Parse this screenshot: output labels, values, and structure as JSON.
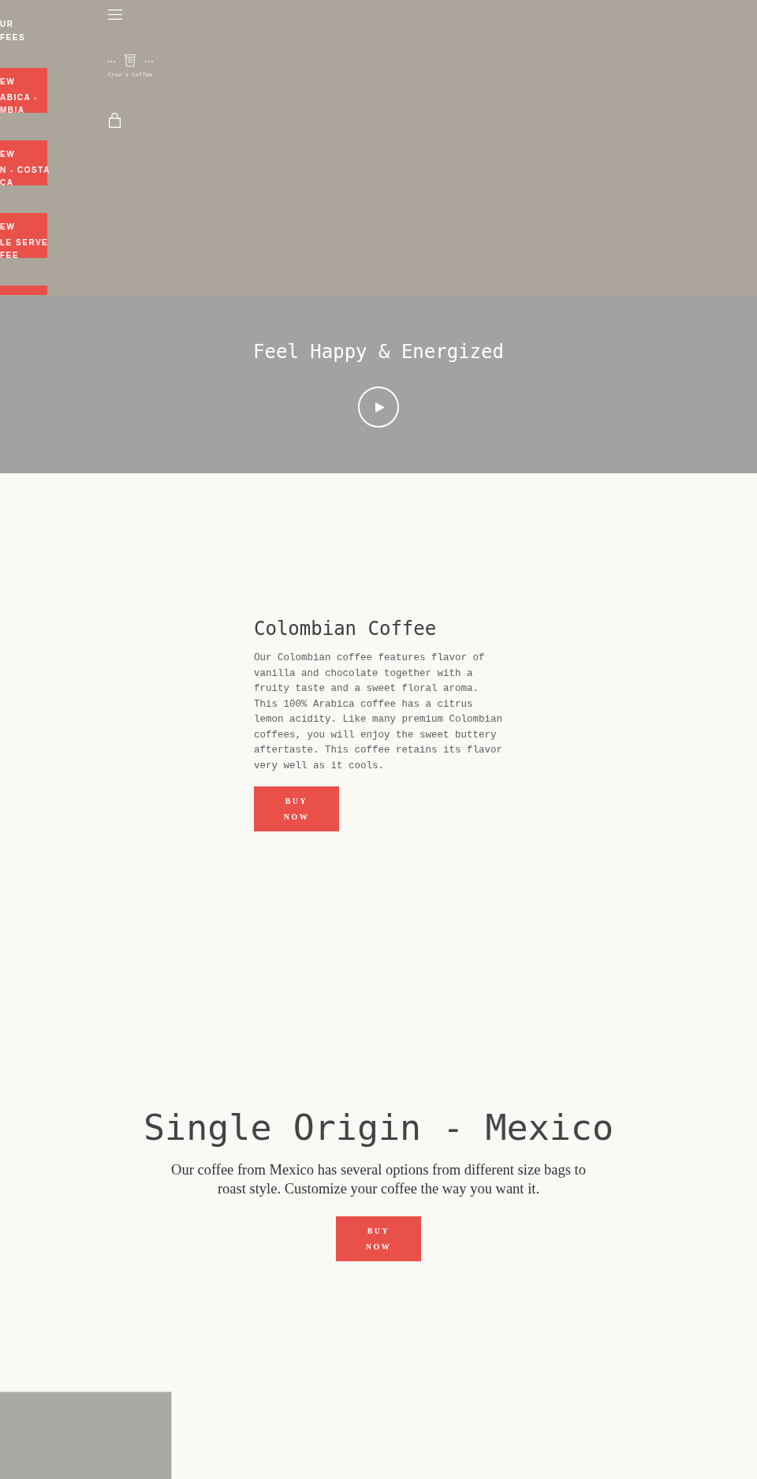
{
  "sidebar": {
    "heading": [
      "UR",
      "FEES"
    ],
    "cards": [
      {
        "label": "EW",
        "title": [
          "ABICA -",
          "MBIA"
        ]
      },
      {
        "label": "EW",
        "title": [
          "N - COSTA",
          "CA"
        ]
      },
      {
        "label": "EW",
        "title": [
          "LE SERVE",
          "FEE"
        ]
      }
    ]
  },
  "header": {
    "logo_text": "Cruz's Coffee"
  },
  "video_banner": {
    "title": "Feel Happy & Energized"
  },
  "featured": {
    "title": "Colombian Coffee",
    "text": "Our Colombian coffee features flavor of vanilla and chocolate together with a fruity taste and a sweet floral aroma. This 100% Arabica coffee has a citrus lemon acidity. Like many premium Colombian coffees, you will enjoy the sweet buttery aftertaste. This coffee retains its flavor very well as it cools.",
    "button": "BUY NOW"
  },
  "product": {
    "title": "Single Origin - Mexico",
    "text": "Our coffee from Mexico has several options from different size bags to roast style. Customize your coffee the way you want it.",
    "button": "BUY NOW"
  }
}
